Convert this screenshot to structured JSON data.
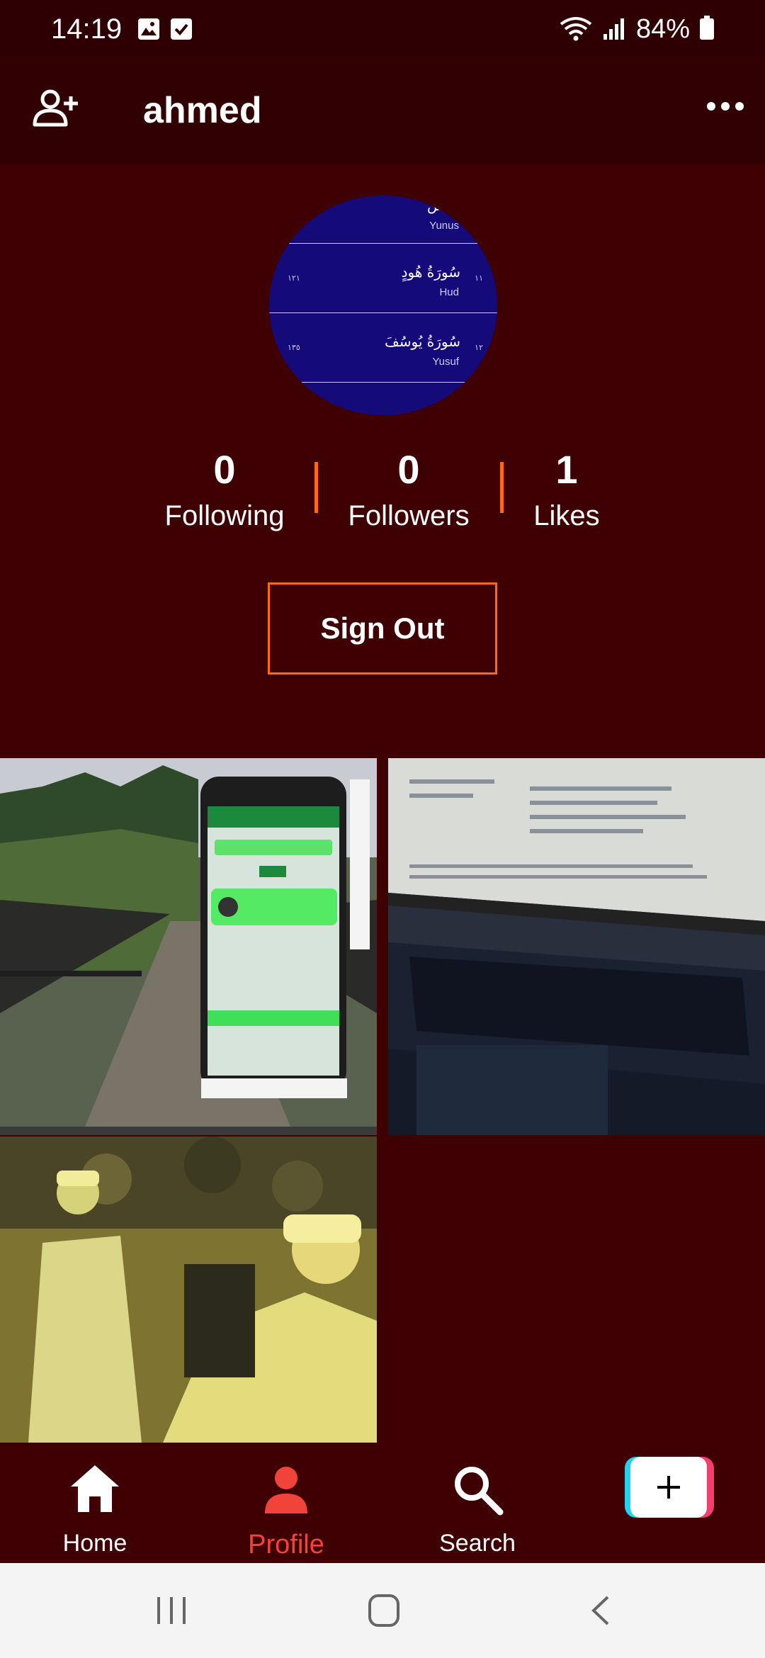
{
  "status_bar": {
    "time": "14:19",
    "battery": "84%"
  },
  "header": {
    "username": "ahmed"
  },
  "avatar": {
    "rows": [
      {
        "ar": "يونس",
        "en": "Yunus",
        "num_left": "",
        "num_right": ""
      },
      {
        "ar": "سُورَةُ هُودٍ",
        "en": "Hud",
        "num_left": "١٢١",
        "num_right": "١١"
      },
      {
        "ar": "سُورَةُ يُوسُفَ",
        "en": "Yusuf",
        "num_left": "١٣٥",
        "num_right": "١٢"
      }
    ]
  },
  "stats": [
    {
      "value": "0",
      "label": "Following"
    },
    {
      "value": "0",
      "label": "Followers"
    },
    {
      "value": "1",
      "label": "Likes"
    }
  ],
  "sign_out_label": "Sign Out",
  "bottom_nav": {
    "home": "Home",
    "profile": "Profile",
    "search": "Search"
  },
  "colors": {
    "background": "#3f0004",
    "accent": "#ff6a1a",
    "active_nav": "#f0433a"
  }
}
